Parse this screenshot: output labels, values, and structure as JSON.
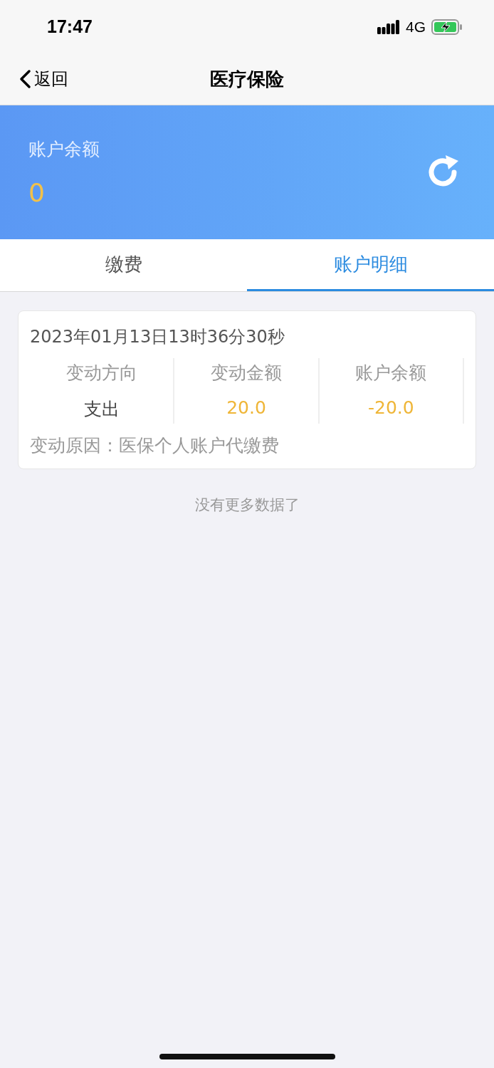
{
  "status_bar": {
    "time": "17:47",
    "network": "4G",
    "charging": true
  },
  "nav": {
    "back_label": "返回",
    "title": "医疗保险"
  },
  "balance": {
    "label": "账户余额",
    "value": "0"
  },
  "tabs": [
    {
      "label": "缴费",
      "selected": false
    },
    {
      "label": "账户明细",
      "selected": true
    }
  ],
  "records": [
    {
      "timestamp": "2023年01月13日13时36分30秒",
      "columns": [
        {
          "header": "变动方向",
          "value": "支出",
          "kind": "plain"
        },
        {
          "header": "变动金额",
          "value": "20.0",
          "kind": "amount"
        },
        {
          "header": "账户余额",
          "value": "-20.0",
          "kind": "amount"
        }
      ],
      "reason": "变动原因：医保个人账户代缴费"
    }
  ],
  "end_note": "没有更多数据了"
}
